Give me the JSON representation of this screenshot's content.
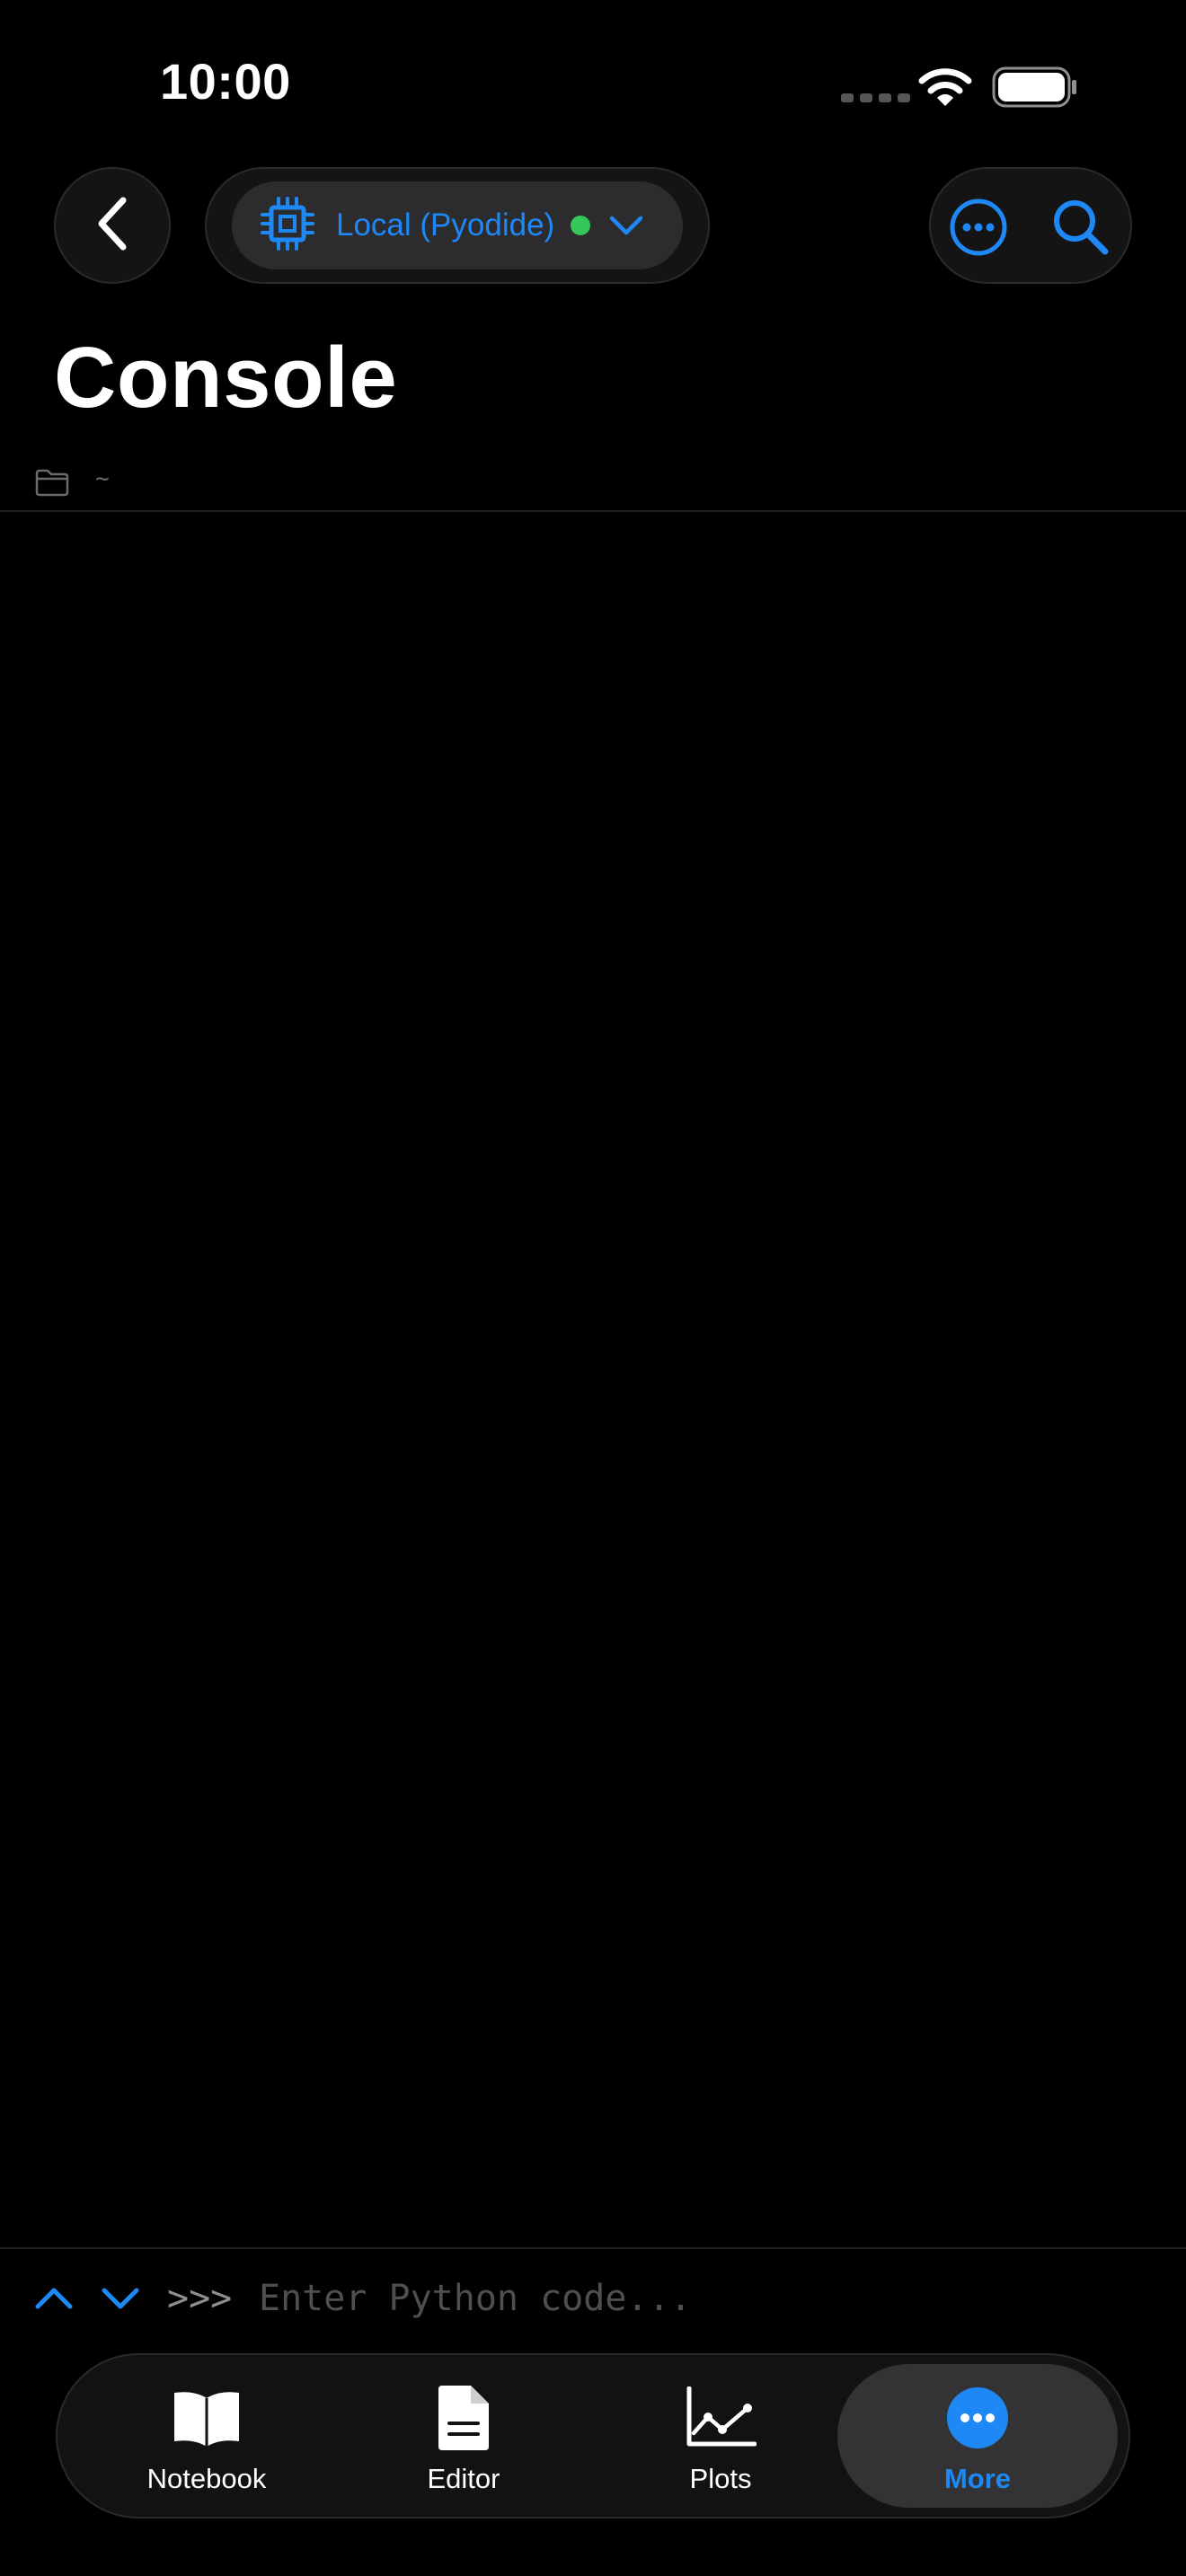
{
  "status_bar": {
    "time": "10:00"
  },
  "header": {
    "kernel": {
      "label": "Local (Pyodide)",
      "status_color": "#34c759",
      "icon": "cpu-chip-icon"
    },
    "title": "Console",
    "cwd": "~"
  },
  "console": {
    "prompt": ">>>",
    "placeholder": "Enter Python code...",
    "value": ""
  },
  "tabbar": {
    "tabs": [
      {
        "label": "Notebook",
        "icon": "book-icon",
        "active": false
      },
      {
        "label": "Editor",
        "icon": "document-icon",
        "active": false
      },
      {
        "label": "Plots",
        "icon": "line-chart-icon",
        "active": false
      },
      {
        "label": "More",
        "icon": "more-circle-icon",
        "active": true
      }
    ]
  },
  "colors": {
    "accent": "#1e88f5",
    "background": "#000000",
    "status_ok": "#34c759"
  }
}
